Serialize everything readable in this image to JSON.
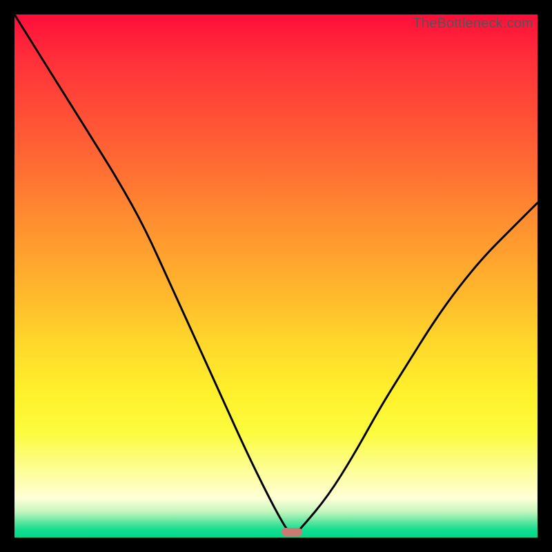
{
  "attribution": "TheBottleneck.com",
  "colors": {
    "frame": "#000000",
    "curve": "#000000",
    "trough_marker": "#cb7a73",
    "gradient_top": "#ff0d3a",
    "gradient_bottom": "#00d98c"
  },
  "chart_data": {
    "type": "line",
    "title": "",
    "xlabel": "",
    "ylabel": "",
    "xlim": [
      0,
      100
    ],
    "ylim": [
      0,
      100
    ],
    "grid": false,
    "legend": false,
    "annotations": [],
    "trough_x": 53,
    "series": [
      {
        "name": "bottleneck-curve",
        "x": [
          0,
          5,
          10,
          15,
          20,
          25,
          30,
          35,
          40,
          45,
          50,
          53,
          55,
          60,
          65,
          70,
          75,
          80,
          85,
          90,
          95,
          100
        ],
        "values": [
          100,
          92,
          84,
          76,
          68,
          59,
          48,
          37,
          26,
          15,
          5,
          0,
          2,
          8,
          16,
          25,
          33,
          41,
          48,
          54,
          59,
          64
        ]
      }
    ]
  }
}
